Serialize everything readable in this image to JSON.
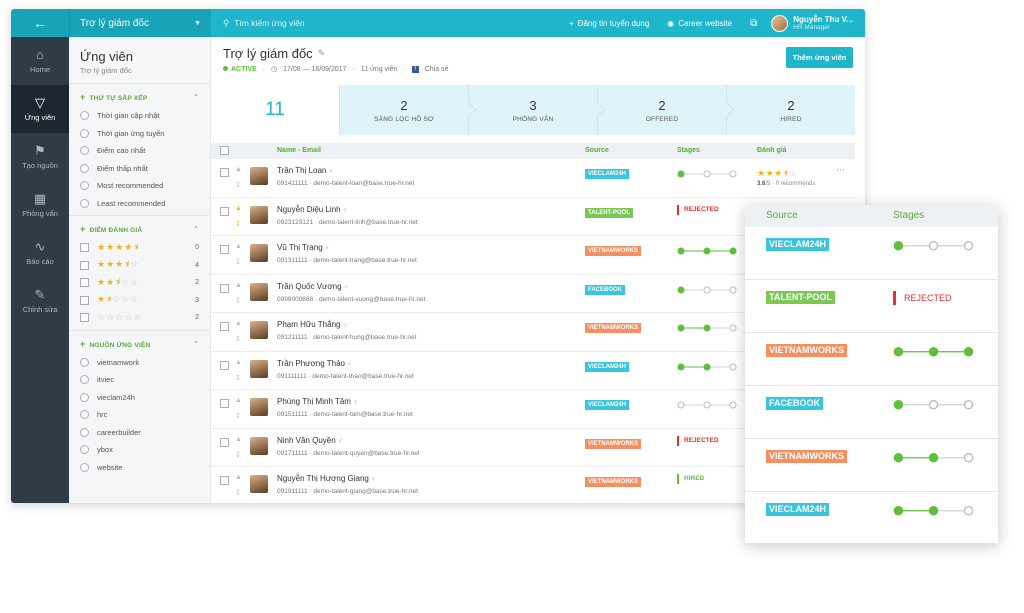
{
  "colors": {
    "primary": "#1fb5cb",
    "primary_dark": "#17a3b8",
    "nav_bg": "#2f3b47",
    "green": "#5fbf3a",
    "red": "#e0322e",
    "star": "#f2b01e",
    "src_vieclam24h": "#39c5dc",
    "src_talentpool": "#7cc855",
    "src_vietnamworks": "#f58f5f",
    "src_facebook": "#39c5dc"
  },
  "topbar": {
    "back_icon": "arrow-left-icon",
    "job_select": "Trợ lý giám đốc",
    "search_placeholder": "Tìm kiếm ứng viên",
    "post_job": "Đăng tin tuyển dụng",
    "career_site": "Career website",
    "user_name": "Nguyễn Thu V...",
    "user_role": "HR Manager"
  },
  "nav": [
    {
      "label": "Home",
      "icon": "home-icon"
    },
    {
      "label": "Ứng viên",
      "icon": "filter-icon"
    },
    {
      "label": "Tạo nguồn",
      "icon": "megaphone-icon"
    },
    {
      "label": "Phỏng vấn",
      "icon": "calendar-icon"
    },
    {
      "label": "Báo cáo",
      "icon": "chart-icon"
    },
    {
      "label": "Chỉnh sửa",
      "icon": "edit-icon"
    }
  ],
  "filters": {
    "title": "Ứng viên",
    "subtitle": "Trợ lý giám đốc",
    "sort_head": "THỨ TỰ SẮP XẾP",
    "sort_options": [
      "Thời gian cập nhật",
      "Thời gian ứng tuyển",
      "Điểm cao nhất",
      "Điểm thấp nhất",
      "Most recommended",
      "Least recommended"
    ],
    "rating_head": "ĐIỂM ĐÁNH GIÁ",
    "ratings": [
      {
        "stars": 4.5,
        "count": "0"
      },
      {
        "stars": 3.5,
        "count": "4"
      },
      {
        "stars": 2.5,
        "count": "2"
      },
      {
        "stars": 1.5,
        "count": "3"
      },
      {
        "stars": 0,
        "count": "2"
      }
    ],
    "source_head": "NGUỒN ỨNG VIÊN",
    "sources": [
      "vietnamwork",
      "itviec",
      "vieclam24h",
      "hrc",
      "careerbuilder",
      "ybox",
      "website"
    ]
  },
  "job": {
    "title": "Trợ lý giám đốc",
    "status": "ACTIVE",
    "dates": "17/08 — 16/09/2017",
    "count": "11 ứng viên",
    "share": "Chia sẻ",
    "add_button": "Thêm ứng viên"
  },
  "pipeline": {
    "total": "11",
    "stages": [
      {
        "count": "2",
        "label": "SÀNG LỌC HỒ SƠ"
      },
      {
        "count": "3",
        "label": "PHỎNG VẤN"
      },
      {
        "count": "2",
        "label": "OFFERED"
      },
      {
        "count": "2",
        "label": "HIRED"
      }
    ]
  },
  "table": {
    "headers": {
      "name": "Name - Email",
      "source": "Source",
      "stages": "Stages",
      "rating": "Đánh giá"
    },
    "rows": [
      {
        "name": "Trần Thị Loan",
        "gender": "♀",
        "phone": "091411111",
        "email": "demo-talent-loan@base.true-hr.net",
        "source": "VIECLAM24H",
        "src_color": "#39c5dc",
        "stage": 1,
        "status": "",
        "pinned": false,
        "stars": 3.5,
        "rating_score": "3.6",
        "rating_of": "/5",
        "rating_rec": "0 recommends"
      },
      {
        "name": "Nguyễn Diệu Linh",
        "gender": "♀",
        "phone": "0923123121",
        "email": "demo-talent-linh@base.true-hr.net",
        "source": "TALENT-POOL",
        "src_color": "#7cc855",
        "stage": 0,
        "status": "REJECTED",
        "pinned": true,
        "stars": 0,
        "rating_score": "",
        "rating_of": "",
        "rating_rec": ""
      },
      {
        "name": "Vũ Thị Trang",
        "gender": "♀",
        "phone": "091311111",
        "email": "demo-talent-trang@base.true-hr.net",
        "source": "VIETNAMWORKS",
        "src_color": "#f58f5f",
        "stage": 3,
        "status": "",
        "pinned": false,
        "stars": 0,
        "rating_score": "",
        "rating_of": "",
        "rating_rec": ""
      },
      {
        "name": "Trần Quốc Vương",
        "gender": "♂",
        "phone": "0999000888",
        "email": "demo-talent-vuong@base.true-hr.net",
        "source": "FACEBOOK",
        "src_color": "#39c5dc",
        "stage": 1,
        "status": "",
        "pinned": false,
        "stars": 0,
        "rating_score": "",
        "rating_of": "",
        "rating_rec": ""
      },
      {
        "name": "Phạm Hữu Thắng",
        "gender": "♂",
        "phone": "091211111",
        "email": "demo-talent-hung@base.true-hr.net",
        "source": "VIETNAMWORKS",
        "src_color": "#f58f5f",
        "stage": 2,
        "status": "",
        "pinned": false,
        "stars": 0,
        "rating_score": "",
        "rating_of": "",
        "rating_rec": ""
      },
      {
        "name": "Trần Phương Thảo",
        "gender": "♀",
        "phone": "091111111",
        "email": "demo-talent-thao@base.true-hr.net",
        "source": "VIECLAM24H",
        "src_color": "#39c5dc",
        "stage": 2,
        "status": "",
        "pinned": false,
        "stars": 0,
        "rating_score": "",
        "rating_of": "",
        "rating_rec": ""
      },
      {
        "name": "Phùng Thị Minh Tâm",
        "gender": "♀",
        "phone": "091511111",
        "email": "demo-talent-tam@base.true-hr.net",
        "source": "VIECLAM24H",
        "src_color": "#39c5dc",
        "stage": 0,
        "status": "",
        "pinned": false,
        "stars": 0,
        "rating_score": "",
        "rating_of": "",
        "rating_rec": ""
      },
      {
        "name": "Ninh Văn Quyền",
        "gender": "♂",
        "phone": "091711111",
        "email": "demo-talent-quyen@base.true-hr.net",
        "source": "VIETNAMWORKS",
        "src_color": "#f58f5f",
        "stage": 0,
        "status": "REJECTED",
        "pinned": false,
        "stars": 0,
        "rating_score": "",
        "rating_of": "",
        "rating_rec": ""
      },
      {
        "name": "Nguyễn Thị Hương Giang",
        "gender": "♀",
        "phone": "091911111",
        "email": "demo-talent-giang@base.true-hr.net",
        "source": "VIETNAMWORKS",
        "src_color": "#f58f5f",
        "stage": 0,
        "status": "HIRED",
        "pinned": false,
        "stars": 0,
        "rating_score": "",
        "rating_of": "",
        "rating_rec": ""
      }
    ]
  },
  "zoom": {
    "headers": {
      "source": "Source",
      "stages": "Stages"
    },
    "rows": [
      {
        "source": "VIECLAM24H",
        "src_color": "#39c5dc",
        "stage": 1,
        "status": ""
      },
      {
        "source": "TALENT-POOL",
        "src_color": "#7cc855",
        "stage": 0,
        "status": "REJECTED"
      },
      {
        "source": "VIETNAMWORKS",
        "src_color": "#f58f5f",
        "stage": 3,
        "status": ""
      },
      {
        "source": "FACEBOOK",
        "src_color": "#39c5dc",
        "stage": 1,
        "status": ""
      },
      {
        "source": "VIETNAMWORKS",
        "src_color": "#f58f5f",
        "stage": 2,
        "status": ""
      },
      {
        "source": "VIECLAM24H",
        "src_color": "#39c5dc",
        "stage": 2,
        "status": ""
      }
    ]
  }
}
